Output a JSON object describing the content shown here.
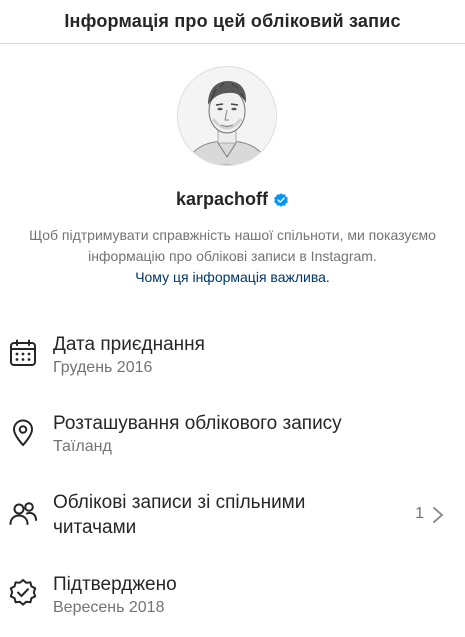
{
  "header": {
    "title": "Інформація про цей обліковий запис"
  },
  "profile": {
    "username": "karpachoff",
    "verified": true,
    "description": "Щоб підтримувати справжність нашої спільноти, ми показуємо інформацію про облікові записи в Instagram.",
    "link_text": "Чому ця інформація важлива."
  },
  "rows": {
    "date_joined": {
      "title": "Дата приєднання",
      "value": "Грудень 2016",
      "icon": "calendar-icon"
    },
    "location": {
      "title": "Розташування облікового запису",
      "value": "Таїланд",
      "icon": "location-pin-icon"
    },
    "mutual": {
      "title_line1": "Облікові записи зі спільними",
      "title_line2": "читачами",
      "count": "1",
      "icon": "people-icon"
    },
    "verified": {
      "title": "Підтверджено",
      "value": "Вересень 2018",
      "icon": "verified-badge-icon"
    }
  },
  "colors": {
    "accent_blue": "#0095f6",
    "link_blue": "#00376b",
    "secondary_text": "#737373",
    "primary_text": "#262626"
  }
}
